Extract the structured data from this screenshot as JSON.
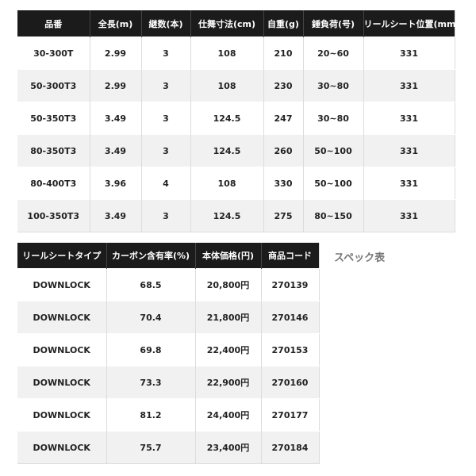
{
  "table1": {
    "headers": [
      "品番",
      "全長(m)",
      "継数(本)",
      "仕舞寸法(cm)",
      "自重(g)",
      "錘負荷(号)",
      "リールシート位置(mm)"
    ],
    "rows": [
      [
        "30-300T",
        "2.99",
        "3",
        "108",
        "210",
        "20~60",
        "331"
      ],
      [
        "50-300T3",
        "2.99",
        "3",
        "108",
        "230",
        "30~80",
        "331"
      ],
      [
        "50-350T3",
        "3.49",
        "3",
        "124.5",
        "247",
        "30~80",
        "331"
      ],
      [
        "80-350T3",
        "3.49",
        "3",
        "124.5",
        "260",
        "50~100",
        "331"
      ],
      [
        "80-400T3",
        "3.96",
        "4",
        "108",
        "330",
        "50~100",
        "331"
      ],
      [
        "100-350T3",
        "3.49",
        "3",
        "124.5",
        "275",
        "80~150",
        "331"
      ]
    ]
  },
  "table2": {
    "headers": [
      "リールシートタイプ",
      "カーボン含有率(%)",
      "本体価格(円)",
      "商品コード"
    ],
    "rows": [
      [
        "DOWNLOCK",
        "68.5",
        "20,800円",
        "270139"
      ],
      [
        "DOWNLOCK",
        "70.4",
        "21,800円",
        "270146"
      ],
      [
        "DOWNLOCK",
        "69.8",
        "22,400円",
        "270153"
      ],
      [
        "DOWNLOCK",
        "73.3",
        "22,900円",
        "270160"
      ],
      [
        "DOWNLOCK",
        "81.2",
        "24,400円",
        "270177"
      ],
      [
        "DOWNLOCK",
        "75.7",
        "23,400円",
        "270184"
      ]
    ]
  },
  "caption": "スペック表",
  "colors": {
    "header_bg": "#1b1b1b",
    "header_text": "#ffffff",
    "row_alt_bg": "#f1f1f1",
    "caption_text": "#777777"
  }
}
